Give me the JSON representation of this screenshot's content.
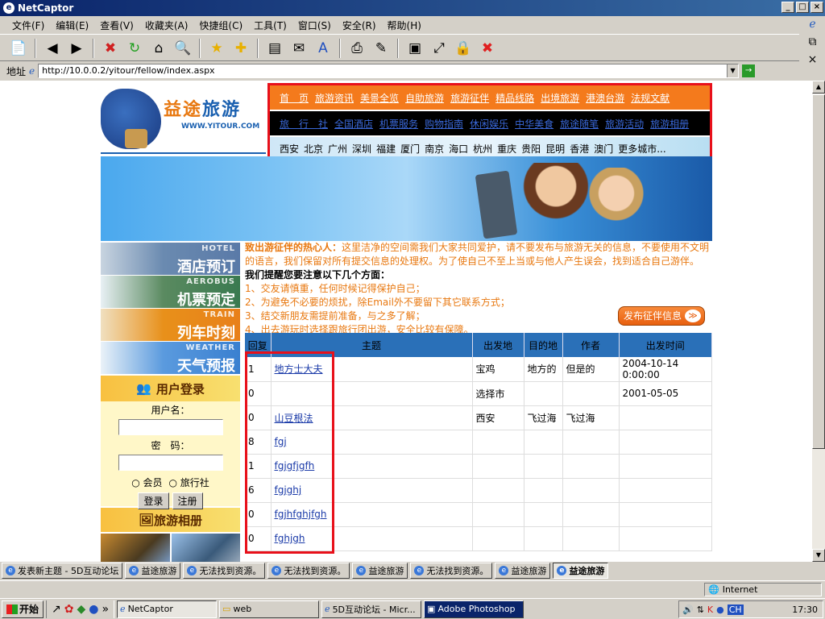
{
  "window": {
    "title": "NetCaptor"
  },
  "menu": [
    "文件(F)",
    "编辑(E)",
    "查看(V)",
    "收藏夹(A)",
    "快捷组(C)",
    "工具(T)",
    "窗口(S)",
    "安全(R)",
    "帮助(H)"
  ],
  "address": {
    "label": "地址",
    "url": "http://10.0.0.2/yitour/fellow/index.aspx"
  },
  "logo": {
    "title_a": "益途",
    "title_b": "旅游",
    "url": "WWW.YITOUR.COM"
  },
  "nav": {
    "row1": [
      "首　页",
      "旅游资讯",
      "美景全览",
      "自助旅游",
      "旅游征伴",
      "精品线路",
      "出境旅游",
      "港澳台游",
      "法规文献"
    ],
    "row2": [
      "旅　行　社",
      "全国酒店",
      "机票服务",
      "购物指南",
      "休闲娱乐",
      "中华美食",
      "旅途随笔",
      "旅游活动",
      "旅游相册"
    ],
    "row3": [
      "西安",
      "北京",
      "广州",
      "深圳",
      "福建",
      "厦门",
      "南京",
      "海口",
      "杭州",
      "重庆",
      "贵阳",
      "昆明",
      "香港",
      "澳门",
      "更多城市..."
    ]
  },
  "sidebar": {
    "services": [
      {
        "en": "HOTEL",
        "cn": "酒店预订"
      },
      {
        "en": "AEROBUS",
        "cn": "机票预定"
      },
      {
        "en": "TRAIN",
        "cn": "列车时刻"
      },
      {
        "en": "WEATHER",
        "cn": "天气预报"
      }
    ],
    "login": {
      "title": "用户登录",
      "username_label": "用户名：",
      "password_label": "密　码：",
      "radio_member": "会员",
      "radio_agency": "旅行社",
      "login_btn": "登录",
      "register_btn": "注册"
    },
    "album_title": "旅游相册"
  },
  "notice": {
    "lead": "致出游征伴的热心人：",
    "p1": "这里洁净的空间需我们大家共同爱护，请不要发布与旅游无关的信息，不要使用不文明的语言，我们保留对所有提交信息的处理权。为了使自己不至上当或与他人产生误会，找到适合自己游伴。",
    "heading": "我们提醒您要注意以下几个方面：",
    "items": [
      "1、交友请慎重，任何时候记得保护自己；",
      "2、为避免不必要的烦扰，除Email外不要留下其它联系方式；",
      "3、结交新朋友需提前准备，与之多了解；",
      "4、出去游玩时选择跟旅行团出游，安全比较有保障。"
    ],
    "publish_btn": "发布征伴信息"
  },
  "table": {
    "headers": [
      "回复",
      "主题",
      "出发地",
      "目的地",
      "作者",
      "出发时间"
    ],
    "rows": [
      [
        "1",
        "地方士大夫",
        "宝鸡",
        "地方的",
        "但是的",
        "2004-10-14 0:00:00"
      ],
      [
        "0",
        "",
        "选择市",
        "",
        "",
        "2001-05-05"
      ],
      [
        "0",
        "山豆根法",
        "西安",
        "飞过海",
        "飞过海",
        ""
      ],
      [
        "8",
        "fgj",
        "",
        "",
        "",
        ""
      ],
      [
        "1",
        "fgjgfjgfh",
        "",
        "",
        "",
        ""
      ],
      [
        "6",
        "fgjghj",
        "",
        "",
        "",
        ""
      ],
      [
        "0",
        "fgjhfghjfgh",
        "",
        "",
        "",
        ""
      ],
      [
        "0",
        "fghjgh",
        "",
        "",
        "",
        ""
      ]
    ]
  },
  "tabs": [
    "发表新主题 - 5D互动论坛",
    "益途旅游",
    "无法找到资源。",
    "无法找到资源。",
    "益途旅游",
    "无法找到资源。",
    "益途旅游",
    "益途旅游"
  ],
  "status": {
    "zone": "Internet"
  },
  "taskbar": {
    "start": "开始",
    "tasks": [
      "NetCaptor",
      "web",
      "5D互动论坛 - Micr...",
      "Adobe Photoshop"
    ],
    "clock": "17:30",
    "lang": "CH"
  }
}
